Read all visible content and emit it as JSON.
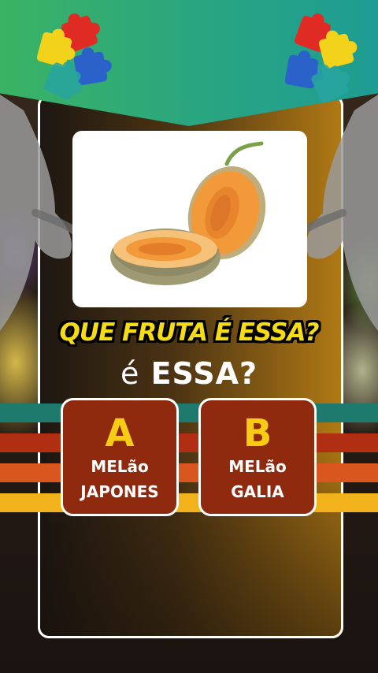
{
  "question": {
    "title": "QUE FRUTA É ESSA?",
    "subtitle_e": "é",
    "subtitle_rest": "ESSA?"
  },
  "image": {
    "subject": "cantaloupe melon halves",
    "icon": "melon-photo"
  },
  "answers": [
    {
      "letter": "A",
      "line1": "MELão",
      "line2": "JAPONES"
    },
    {
      "letter": "B",
      "line1": "MELão",
      "line2": "GALIA"
    }
  ],
  "colors": {
    "banner_green": "#3bb364",
    "banner_teal": "#1e9c93",
    "title_yellow": "#f6dc16",
    "answer_bg": "#8f2a0f",
    "stripe_teal": "#1f7a6e",
    "stripe_red": "#b02f12",
    "stripe_orange": "#d9561e",
    "stripe_yellow": "#f1b21c"
  },
  "decorations": {
    "left_puzzle_icon": "puzzle-pieces-icon",
    "right_puzzle_icon": "puzzle-pieces-icon",
    "hands": "pointing-hands"
  }
}
